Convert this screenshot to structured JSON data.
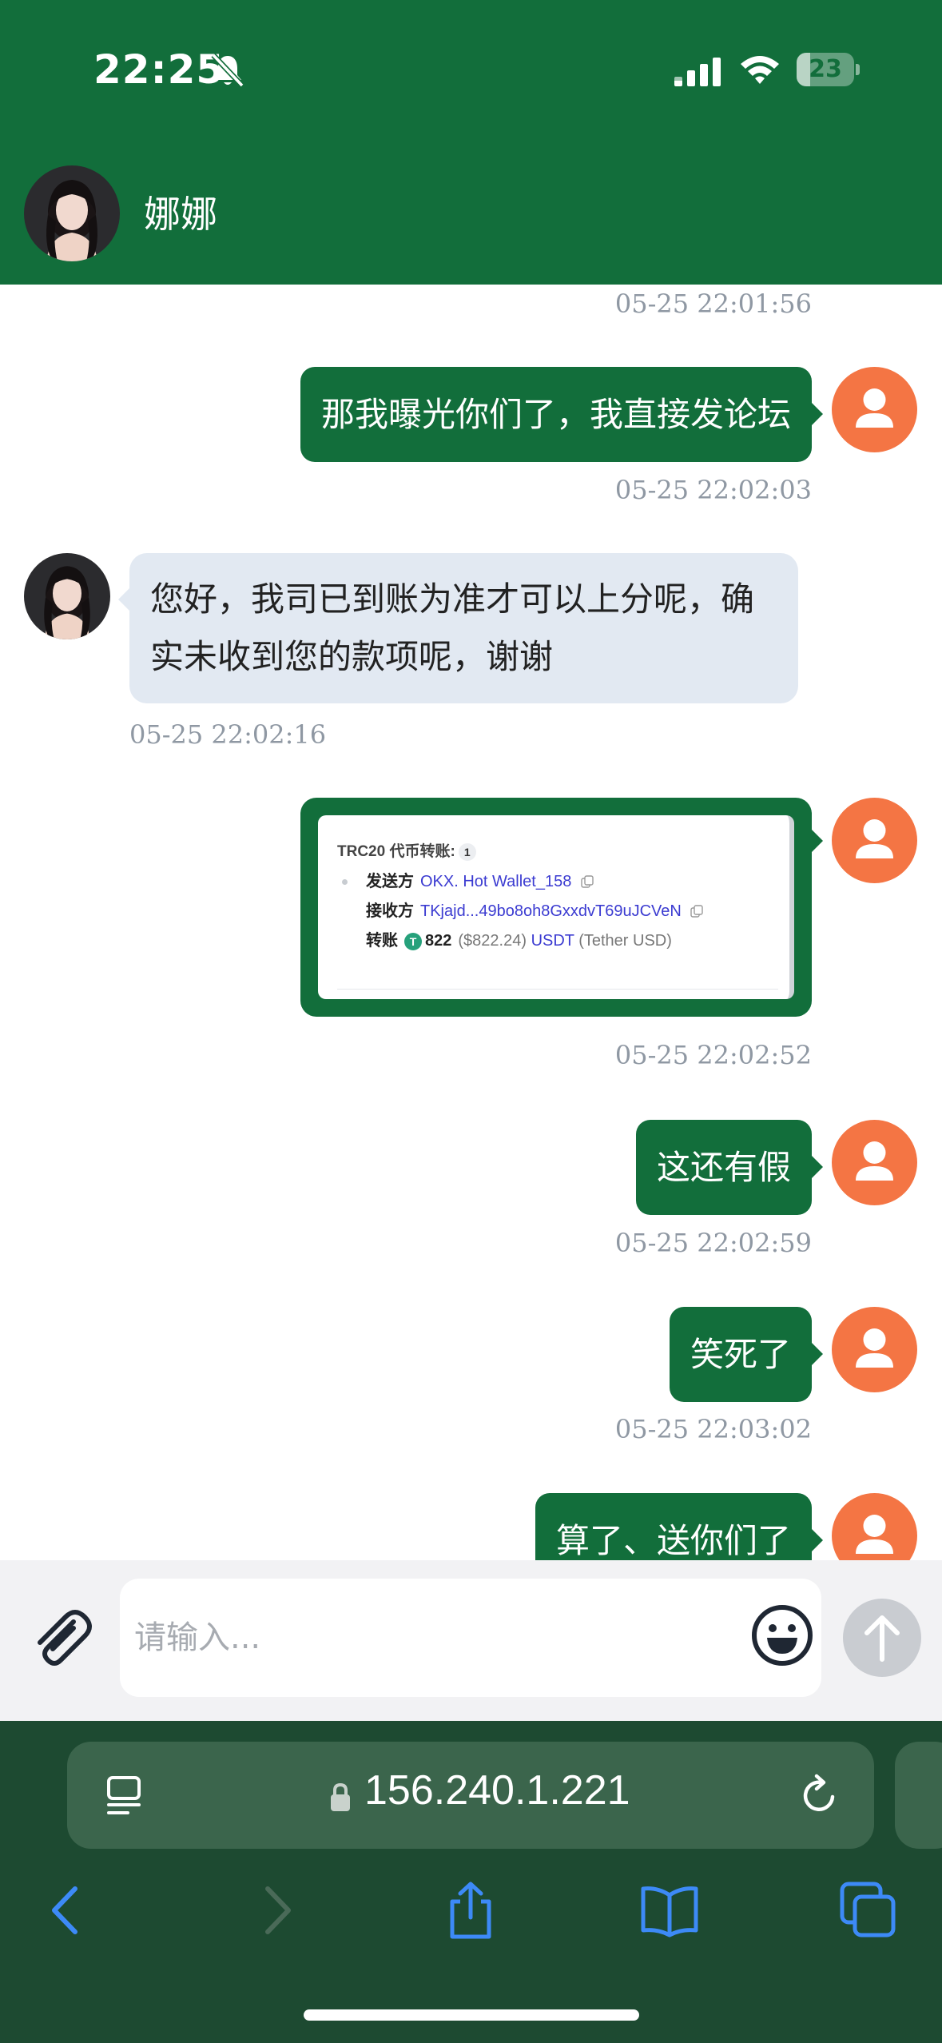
{
  "status_bar": {
    "time": "22:25",
    "battery": "23",
    "battery_fraction": 0.23
  },
  "header": {
    "contact_name": "娜娜"
  },
  "chat": {
    "messages": [
      {
        "type": "timestamp",
        "text": "05-25 22:01:56"
      },
      {
        "type": "outgoing",
        "text": "那我曝光你们了，我直接发论坛",
        "timestamp": "05-25 22:02:03"
      },
      {
        "type": "incoming",
        "text": "您好，我司已到账为准才可以上分呢，确实未收到您的款项呢，谢谢",
        "timestamp": "05-25 22:02:16"
      },
      {
        "type": "outgoing_image",
        "timestamp": "05-25 22:02:52",
        "card": {
          "title": "TRC20 代币转账:",
          "count": "1",
          "from_label": "发送方",
          "from_value": "OKX. Hot Wallet_158",
          "to_label": "接收方",
          "to_value": "TKjajd...49bo8oh8GxxdvT69uJCVeN",
          "amount_label": "转账",
          "amount": "822",
          "amount_usd": "($822.24)",
          "token": "USDT",
          "token_name": "(Tether USD)"
        }
      },
      {
        "type": "outgoing",
        "text": "这还有假",
        "timestamp": "05-25 22:02:59"
      },
      {
        "type": "outgoing",
        "text": "笑死了",
        "timestamp": "05-25 22:03:02"
      },
      {
        "type": "outgoing",
        "text": "算了、送你们了"
      }
    ]
  },
  "input": {
    "placeholder": "请输入..."
  },
  "browser": {
    "url": "156.240.1.221"
  },
  "icons": {
    "status": [
      "bell-slash-icon",
      "signal-icon",
      "wifi-icon",
      "battery-icon"
    ],
    "input": [
      "paperclip-icon",
      "emoji-icon",
      "send-arrow-icon"
    ],
    "browser": [
      "reader-icon",
      "lock-icon",
      "reload-icon",
      "back-icon",
      "forward-icon",
      "share-icon",
      "bookmarks-icon",
      "tabs-icon"
    ]
  },
  "colors": {
    "brand_green": "#126e3b",
    "incoming_bubble": "#e2e9f2",
    "user_avatar": "#f47544",
    "timestamp": "#8f98a3",
    "browser_bar": "#1d4a31",
    "url_bar": "#3b654c",
    "ios_blue": "#3d8af7"
  }
}
